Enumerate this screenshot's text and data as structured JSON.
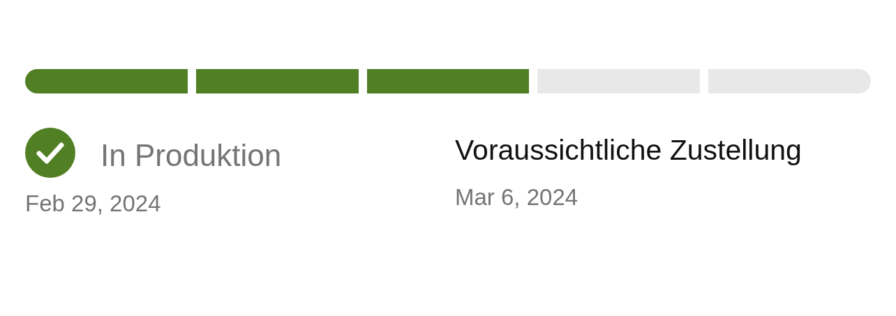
{
  "progress": {
    "segments": [
      {
        "completed": true
      },
      {
        "completed": true
      },
      {
        "completed": true
      },
      {
        "completed": false
      },
      {
        "completed": false
      }
    ]
  },
  "status": {
    "label": "In Produktion",
    "date": "Feb 29, 2024",
    "done": true
  },
  "delivery": {
    "label": "Voraussichtliche Zustellung",
    "date": "Mar 6, 2024"
  }
}
